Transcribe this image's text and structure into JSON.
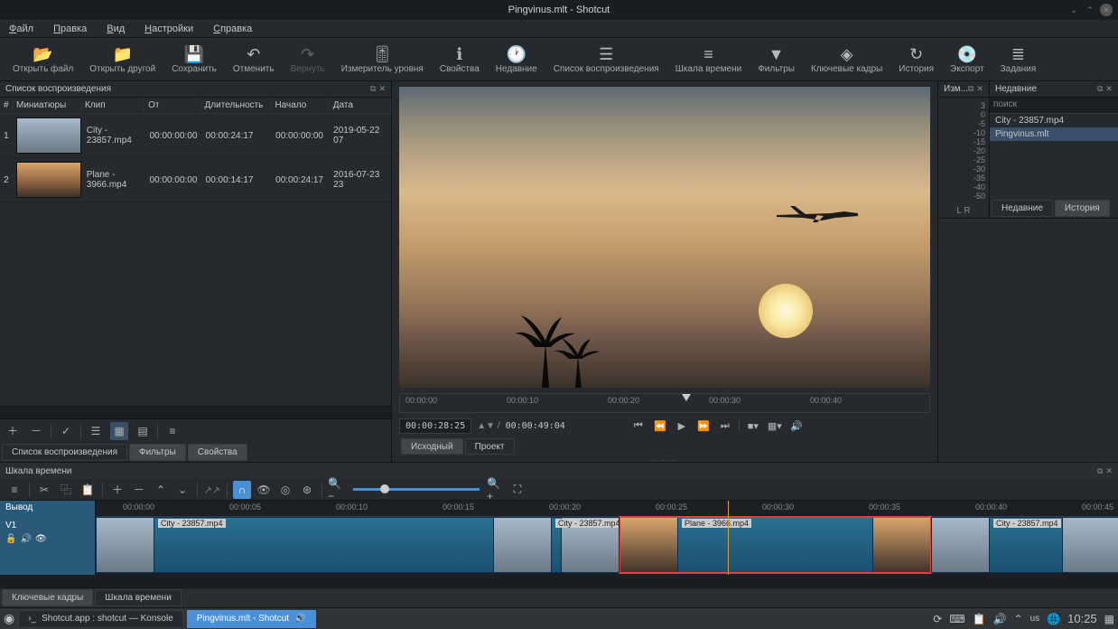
{
  "titlebar": {
    "title": "Pingvinus.mlt - Shotcut"
  },
  "menu": {
    "file": "Файл",
    "edit": "Правка",
    "view": "Вид",
    "settings": "Настройки",
    "help": "Справка"
  },
  "toolbar": {
    "open_file": "Открыть файл",
    "open_other": "Открыть другой",
    "save": "Сохранить",
    "undo": "Отменить",
    "redo": "Вернуть",
    "peak_meter": "Измеритель уровня",
    "properties": "Свойства",
    "recent": "Недавние",
    "playlist": "Список воспроизведения",
    "timeline": "Шкала времени",
    "filters": "Фильтры",
    "keyframes": "Ключевые кадры",
    "history": "История",
    "export": "Экспорт",
    "jobs": "Задания"
  },
  "playlist": {
    "title": "Список воспроизведения",
    "cols": {
      "num": "#",
      "thumb": "Миниатюры",
      "clip": "Клип",
      "from": "От",
      "dur": "Длительность",
      "start": "Начало",
      "date": "Дата"
    },
    "rows": [
      {
        "idx": "1",
        "clip": "City - 23857.mp4",
        "from": "00:00:00:00",
        "dur": "00:00:24:17",
        "start": "00:00:00:00",
        "date": "2019-05-22 07"
      },
      {
        "idx": "2",
        "clip": "Plane - 3966.mp4",
        "from": "00:00:00:00",
        "dur": "00:00:14:17",
        "start": "00:00:24:17",
        "date": "2016-07-23 23"
      }
    ],
    "tabs": {
      "playlist": "Список воспроизведения",
      "filters": "Фильтры",
      "properties": "Свойства"
    }
  },
  "preview": {
    "ruler": [
      "00:00:00",
      "00:00:10",
      "00:00:20",
      "00:00:30",
      "00:00:40"
    ],
    "tc_current": "00:00:28:25",
    "tc_total": "00:00:49:04",
    "tabs": {
      "source": "Исходный",
      "project": "Проект"
    }
  },
  "right": {
    "meter_title": "Изм...",
    "recent_title": "Недавние",
    "search_placeholder": "поиск",
    "recent": [
      "City - 23857.mp4",
      "Pingvinus.mlt"
    ],
    "scale": [
      "3",
      "0",
      "-5",
      "-10",
      "-15",
      "-20",
      "-25",
      "-30",
      "-35",
      "-40",
      "-50"
    ],
    "lr": "L   R",
    "tabs": {
      "recent": "Недавние",
      "history": "История"
    }
  },
  "timeline": {
    "title": "Шкала времени",
    "output": "Вывод",
    "track_name": "V1",
    "ruler": [
      "00:00:00",
      "00:00:05",
      "00:00:10",
      "00:00:15",
      "00:00:20",
      "00:00:25",
      "00:00:30",
      "00:00:35",
      "00:00:40",
      "00:00:45"
    ],
    "clips": [
      {
        "label": "City - 23857.mp4"
      },
      {
        "label": "City - 23857.mp4"
      },
      {
        "label": "Plane - 3966.mp4"
      },
      {
        "label": "City - 23857.mp4"
      }
    ],
    "tabs": {
      "keyframes": "Ключевые кадры",
      "timeline": "Шкала времени"
    }
  },
  "taskbar": {
    "task1": "Shotcut.app : shotcut — Konsole",
    "task2": "Pingvinus.mlt - Shotcut",
    "lang": "us",
    "clock": "10:25"
  }
}
